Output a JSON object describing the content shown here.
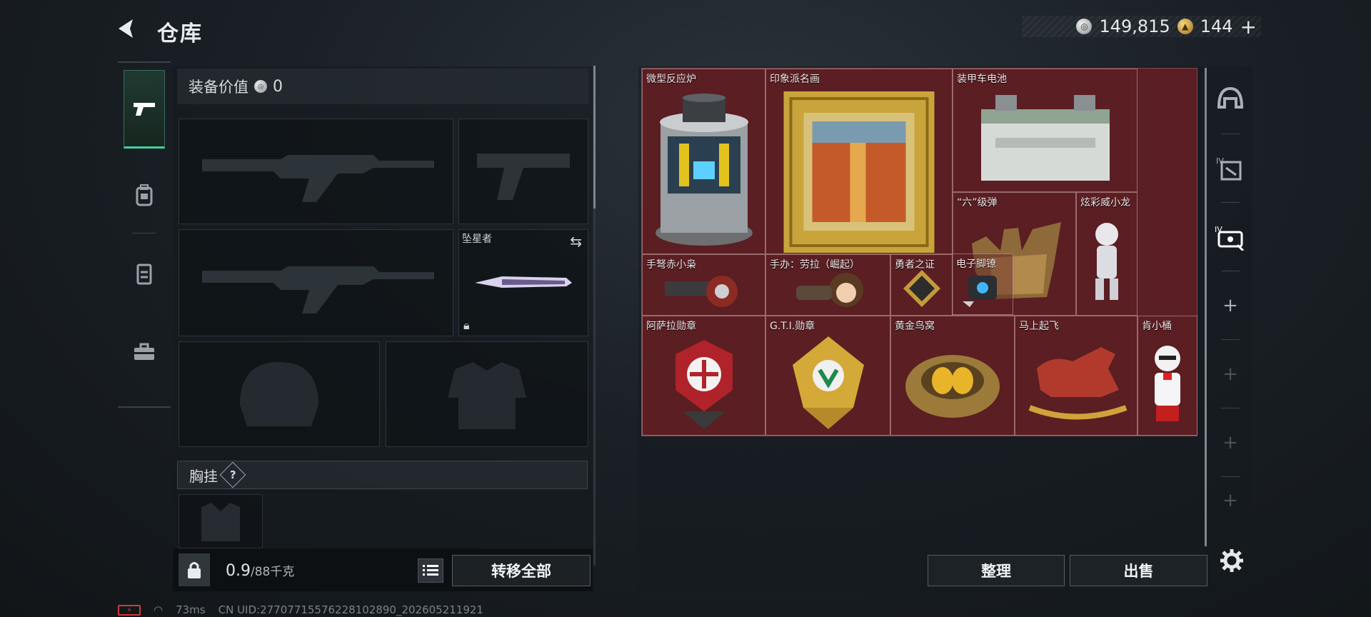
{
  "header": {
    "title": "仓库",
    "currency_silver": "149,815",
    "currency_gold": "144",
    "add_label": "+"
  },
  "equipment": {
    "value_label": "装备价值",
    "value": "0",
    "melee_slot_label": "坠星者",
    "chest_rig_label": "胸挂",
    "chest_help": "?"
  },
  "weight": {
    "current": "0.9",
    "max": "/88千克"
  },
  "buttons": {
    "transfer_all": "转移全部",
    "sort": "整理",
    "sell": "出售"
  },
  "stash_items": [
    {
      "name": "微型反应炉",
      "icon": "reactor-icon"
    },
    {
      "name": "印象派名画",
      "icon": "painting-icon"
    },
    {
      "name": "装甲车电池",
      "icon": "battery-icon"
    },
    {
      "name": "“六”级弹",
      "icon": "hand-sculpture-icon"
    },
    {
      "name": "炫彩威小龙",
      "icon": "figure-icon"
    },
    {
      "name": "手弩赤小枭",
      "icon": "crossbow-toy-icon"
    },
    {
      "name": "手办：劳拉（崛起）",
      "icon": "figurine-icon"
    },
    {
      "name": "勇者之证",
      "icon": "badge-icon"
    },
    {
      "name": "电子脚镣",
      "icon": "ankle-monitor-icon"
    },
    {
      "name": "阿萨拉勋章",
      "icon": "medal-red-icon"
    },
    {
      "name": "G.T.I.勋章",
      "icon": "medal-gold-icon"
    },
    {
      "name": "黄金鸟窝",
      "icon": "golden-nest-icon"
    },
    {
      "name": "马上起飞",
      "icon": "rocking-horse-icon"
    },
    {
      "name": "肯小桶",
      "icon": "colonel-figure-icon"
    }
  ],
  "filters": [
    "helmet-icon",
    "tier-4-armor-icon",
    "tier-4-ticket-icon",
    "add-icon",
    "add-icon",
    "add-icon",
    "add-icon"
  ],
  "status": {
    "ping": "73ms",
    "uid": "CN UID:2770771557622810289​0_202605211921"
  },
  "colors": {
    "stash_bg": "#5a1e24",
    "active_green": "#3fd39a"
  }
}
